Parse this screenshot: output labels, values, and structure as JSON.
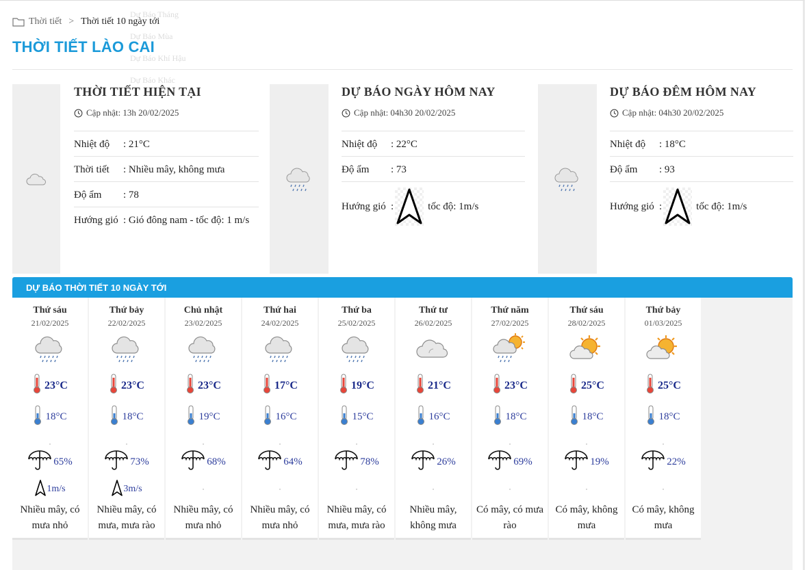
{
  "breadcrumb": {
    "home": "Thời tiết",
    "separator": ">",
    "current": "Thời tiết 10 ngày tới"
  },
  "ghost_menu": [
    "Dự Báo Tháng",
    "Dự Báo Mùa",
    "Dự Báo Khí Hậu",
    "Dự Báo Khác"
  ],
  "page_title": "THỜI TIẾT LÀO CAI",
  "current": {
    "title": "THỜI TIẾT HIỆN TẠI",
    "updated": "Cập nhật: 13h 20/02/2025",
    "icon": "cloud-icon",
    "rows": [
      {
        "label": "Nhiệt độ",
        "value": ": 21°C"
      },
      {
        "label": "Thời tiết",
        "value": ": Nhiều mây, không mưa"
      },
      {
        "label": "Độ ẩm",
        "value": ": 78"
      },
      {
        "label": "Hướng gió",
        "value": ": Gió đông nam - tốc độ: 1 m/s"
      }
    ]
  },
  "today": {
    "title": "DỰ BÁO NGÀY HÔM NAY",
    "updated": "Cập nhật: 04h30 20/02/2025",
    "icon": "rain-cloud-icon",
    "rows": [
      {
        "label": "Nhiệt độ",
        "value": ": 22°C"
      },
      {
        "label": "Độ ẩm",
        "value": ": 73"
      },
      {
        "label": "Hướng gió",
        "colon": ":",
        "value": "tốc độ: 1m/s"
      }
    ]
  },
  "tonight": {
    "title": "DỰ BÁO ĐÊM HÔM NAY",
    "updated": "Cập nhật: 04h30 20/02/2025",
    "icon": "rain-cloud-icon",
    "rows": [
      {
        "label": "Nhiệt độ",
        "value": ": 18°C"
      },
      {
        "label": "Độ ẩm",
        "value": ": 93"
      },
      {
        "label": "Hướng gió",
        "colon": ":",
        "value": "tốc độ: 1m/s"
      }
    ]
  },
  "forecast_header": "DỰ BÁO THỜI TIẾT 10 NGÀY TỚI",
  "days": [
    {
      "name": "Thứ sáu",
      "date": "21/02/2025",
      "icon": "rain-cloud-icon",
      "max": "23°C",
      "min": "18°C",
      "rain": "65%",
      "wind": "1m/s",
      "desc": "Nhiều mây, có mưa nhỏ"
    },
    {
      "name": "Thứ bảy",
      "date": "22/02/2025",
      "icon": "rain-cloud-icon",
      "max": "23°C",
      "min": "18°C",
      "rain": "73%",
      "wind": "3m/s",
      "desc": "Nhiều mây, có mưa, mưa rào"
    },
    {
      "name": "Chủ nhật",
      "date": "23/02/2025",
      "icon": "rain-cloud-icon",
      "max": "23°C",
      "min": "19°C",
      "rain": "68%",
      "wind": "",
      "desc": "Nhiều mây, có mưa nhỏ"
    },
    {
      "name": "Thứ hai",
      "date": "24/02/2025",
      "icon": "rain-cloud-icon",
      "max": "17°C",
      "min": "16°C",
      "rain": "64%",
      "wind": "",
      "desc": "Nhiều mây, có mưa nhỏ"
    },
    {
      "name": "Thứ ba",
      "date": "25/02/2025",
      "icon": "rain-cloud-icon",
      "max": "19°C",
      "min": "15°C",
      "rain": "78%",
      "wind": "",
      "desc": "Nhiều mây, có mưa, mưa rào"
    },
    {
      "name": "Thứ tư",
      "date": "26/02/2025",
      "icon": "cloud-icon",
      "max": "21°C",
      "min": "16°C",
      "rain": "26%",
      "wind": "",
      "desc": "Nhiều mây, không mưa"
    },
    {
      "name": "Thứ năm",
      "date": "27/02/2025",
      "icon": "sun-rain-cloud-icon",
      "max": "23°C",
      "min": "18°C",
      "rain": "69%",
      "wind": "",
      "desc": "Có mây, có mưa rào"
    },
    {
      "name": "Thứ sáu",
      "date": "28/02/2025",
      "icon": "sun-cloud-icon",
      "max": "25°C",
      "min": "18°C",
      "rain": "19%",
      "wind": "",
      "desc": "Có mây, không mưa"
    },
    {
      "name": "Thứ bảy",
      "date": "01/03/2025",
      "icon": "sun-cloud-icon",
      "max": "25°C",
      "min": "18°C",
      "rain": "22%",
      "wind": "",
      "desc": "Có mây, không mưa"
    }
  ],
  "colors": {
    "accent": "#1a9fe0",
    "title": "#1b9ad9",
    "temp_max": "#1a2a8a",
    "temp_min": "#2c3c9c"
  }
}
